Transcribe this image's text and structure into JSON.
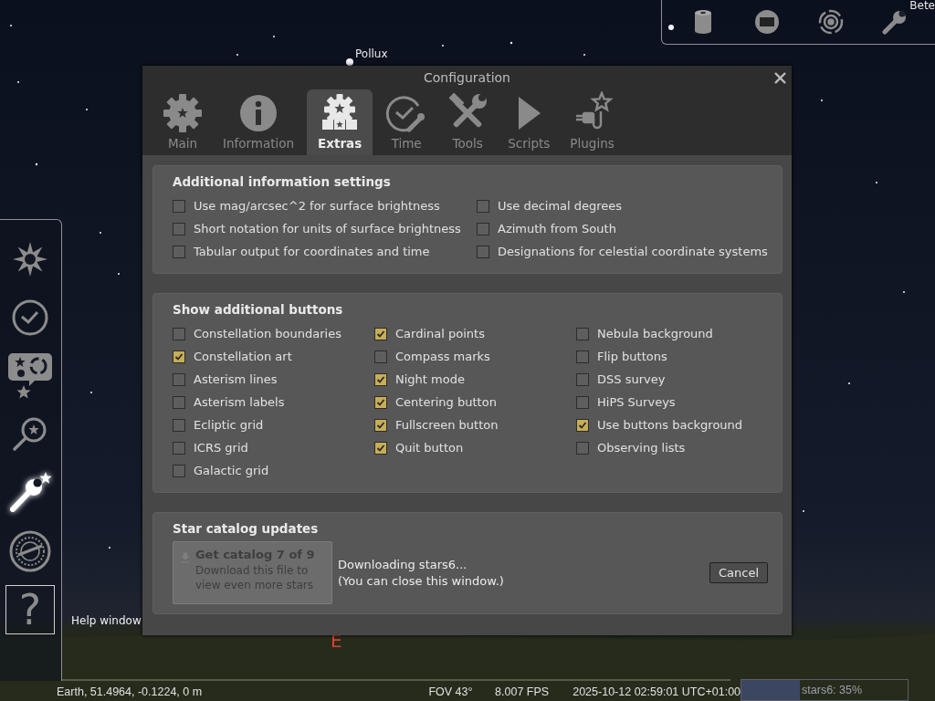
{
  "sky": {
    "labels": [
      {
        "text": "Pollux",
        "kind": "star"
      },
      {
        "text": "Bete",
        "kind": "star"
      },
      {
        "text": "E",
        "kind": "cardinal"
      }
    ]
  },
  "top_toolbar": {
    "buttons": [
      {
        "selected": false
      },
      {
        "selected": false
      },
      {
        "selected": false
      },
      {
        "selected": false
      }
    ]
  },
  "left_toolbar": {
    "buttons": [
      {
        "selected": false,
        "hovered": false
      },
      {
        "selected": false,
        "hovered": false
      },
      {
        "selected": false,
        "hovered": false
      },
      {
        "selected": false,
        "hovered": false
      },
      {
        "selected": true,
        "hovered": false
      },
      {
        "selected": false,
        "hovered": false
      },
      {
        "selected": false,
        "hovered": true,
        "label": "?"
      }
    ],
    "tooltip": "Help window"
  },
  "dialog": {
    "title": "Configuration",
    "tabs": [
      {
        "label": "Main",
        "selected": false
      },
      {
        "label": "Information",
        "selected": false
      },
      {
        "label": "Extras",
        "selected": true
      },
      {
        "label": "Time",
        "selected": false
      },
      {
        "label": "Tools",
        "selected": false
      },
      {
        "label": "Scripts",
        "selected": false
      },
      {
        "label": "Plugins",
        "selected": false
      }
    ],
    "sections": [
      {
        "title": "Additional information settings",
        "columns": [
          [
            {
              "label": "Use mag/arcsec^2 for surface brightness",
              "checked": false
            },
            {
              "label": "Short notation for units of surface brightness",
              "checked": false
            },
            {
              "label": "Tabular output for coordinates and time",
              "checked": false
            }
          ],
          [
            {
              "label": "Use decimal degrees",
              "checked": false
            },
            {
              "label": "Azimuth from South",
              "checked": false
            },
            {
              "label": "Designations for celestial coordinate systems",
              "checked": false
            }
          ]
        ]
      },
      {
        "title": "Show additional buttons",
        "columns": [
          [
            {
              "label": "Constellation boundaries",
              "checked": false
            },
            {
              "label": "Constellation art",
              "checked": true
            },
            {
              "label": "Asterism lines",
              "checked": false
            },
            {
              "label": "Asterism labels",
              "checked": false
            },
            {
              "label": "Ecliptic grid",
              "checked": false
            },
            {
              "label": "ICRS grid",
              "checked": false
            },
            {
              "label": "Galactic grid",
              "checked": false
            }
          ],
          [
            {
              "label": "Cardinal points",
              "checked": true
            },
            {
              "label": "Compass marks",
              "checked": false
            },
            {
              "label": "Night mode",
              "checked": true
            },
            {
              "label": "Centering button",
              "checked": true
            },
            {
              "label": "Fullscreen button",
              "checked": true
            },
            {
              "label": "Quit button",
              "checked": true
            }
          ],
          [
            {
              "label": "Nebula background",
              "checked": false
            },
            {
              "label": "Flip buttons",
              "checked": false
            },
            {
              "label": "DSS survey",
              "checked": false
            },
            {
              "label": "HiPS Surveys",
              "checked": false
            },
            {
              "label": "Use buttons background",
              "checked": true
            },
            {
              "label": "Observing lists",
              "checked": false
            }
          ]
        ]
      }
    ],
    "catalog": {
      "title": "Star catalog updates",
      "button": {
        "title": "Get catalog 7 of 9",
        "description": "Download this file to view even more stars",
        "disabled": true
      },
      "status": [
        "Downloading stars6...",
        "(You can close this window.)"
      ],
      "cancel": "Cancel"
    }
  },
  "status_bar": {
    "location": "Earth, 51.4964, -0.1224, 0 m",
    "fov": "FOV 43°",
    "fps": "8.007 FPS",
    "datetime": "2025-10-12 02:59:01 UTC+01:00",
    "progress": {
      "label": "stars6: 35%",
      "level": 0.35
    }
  }
}
